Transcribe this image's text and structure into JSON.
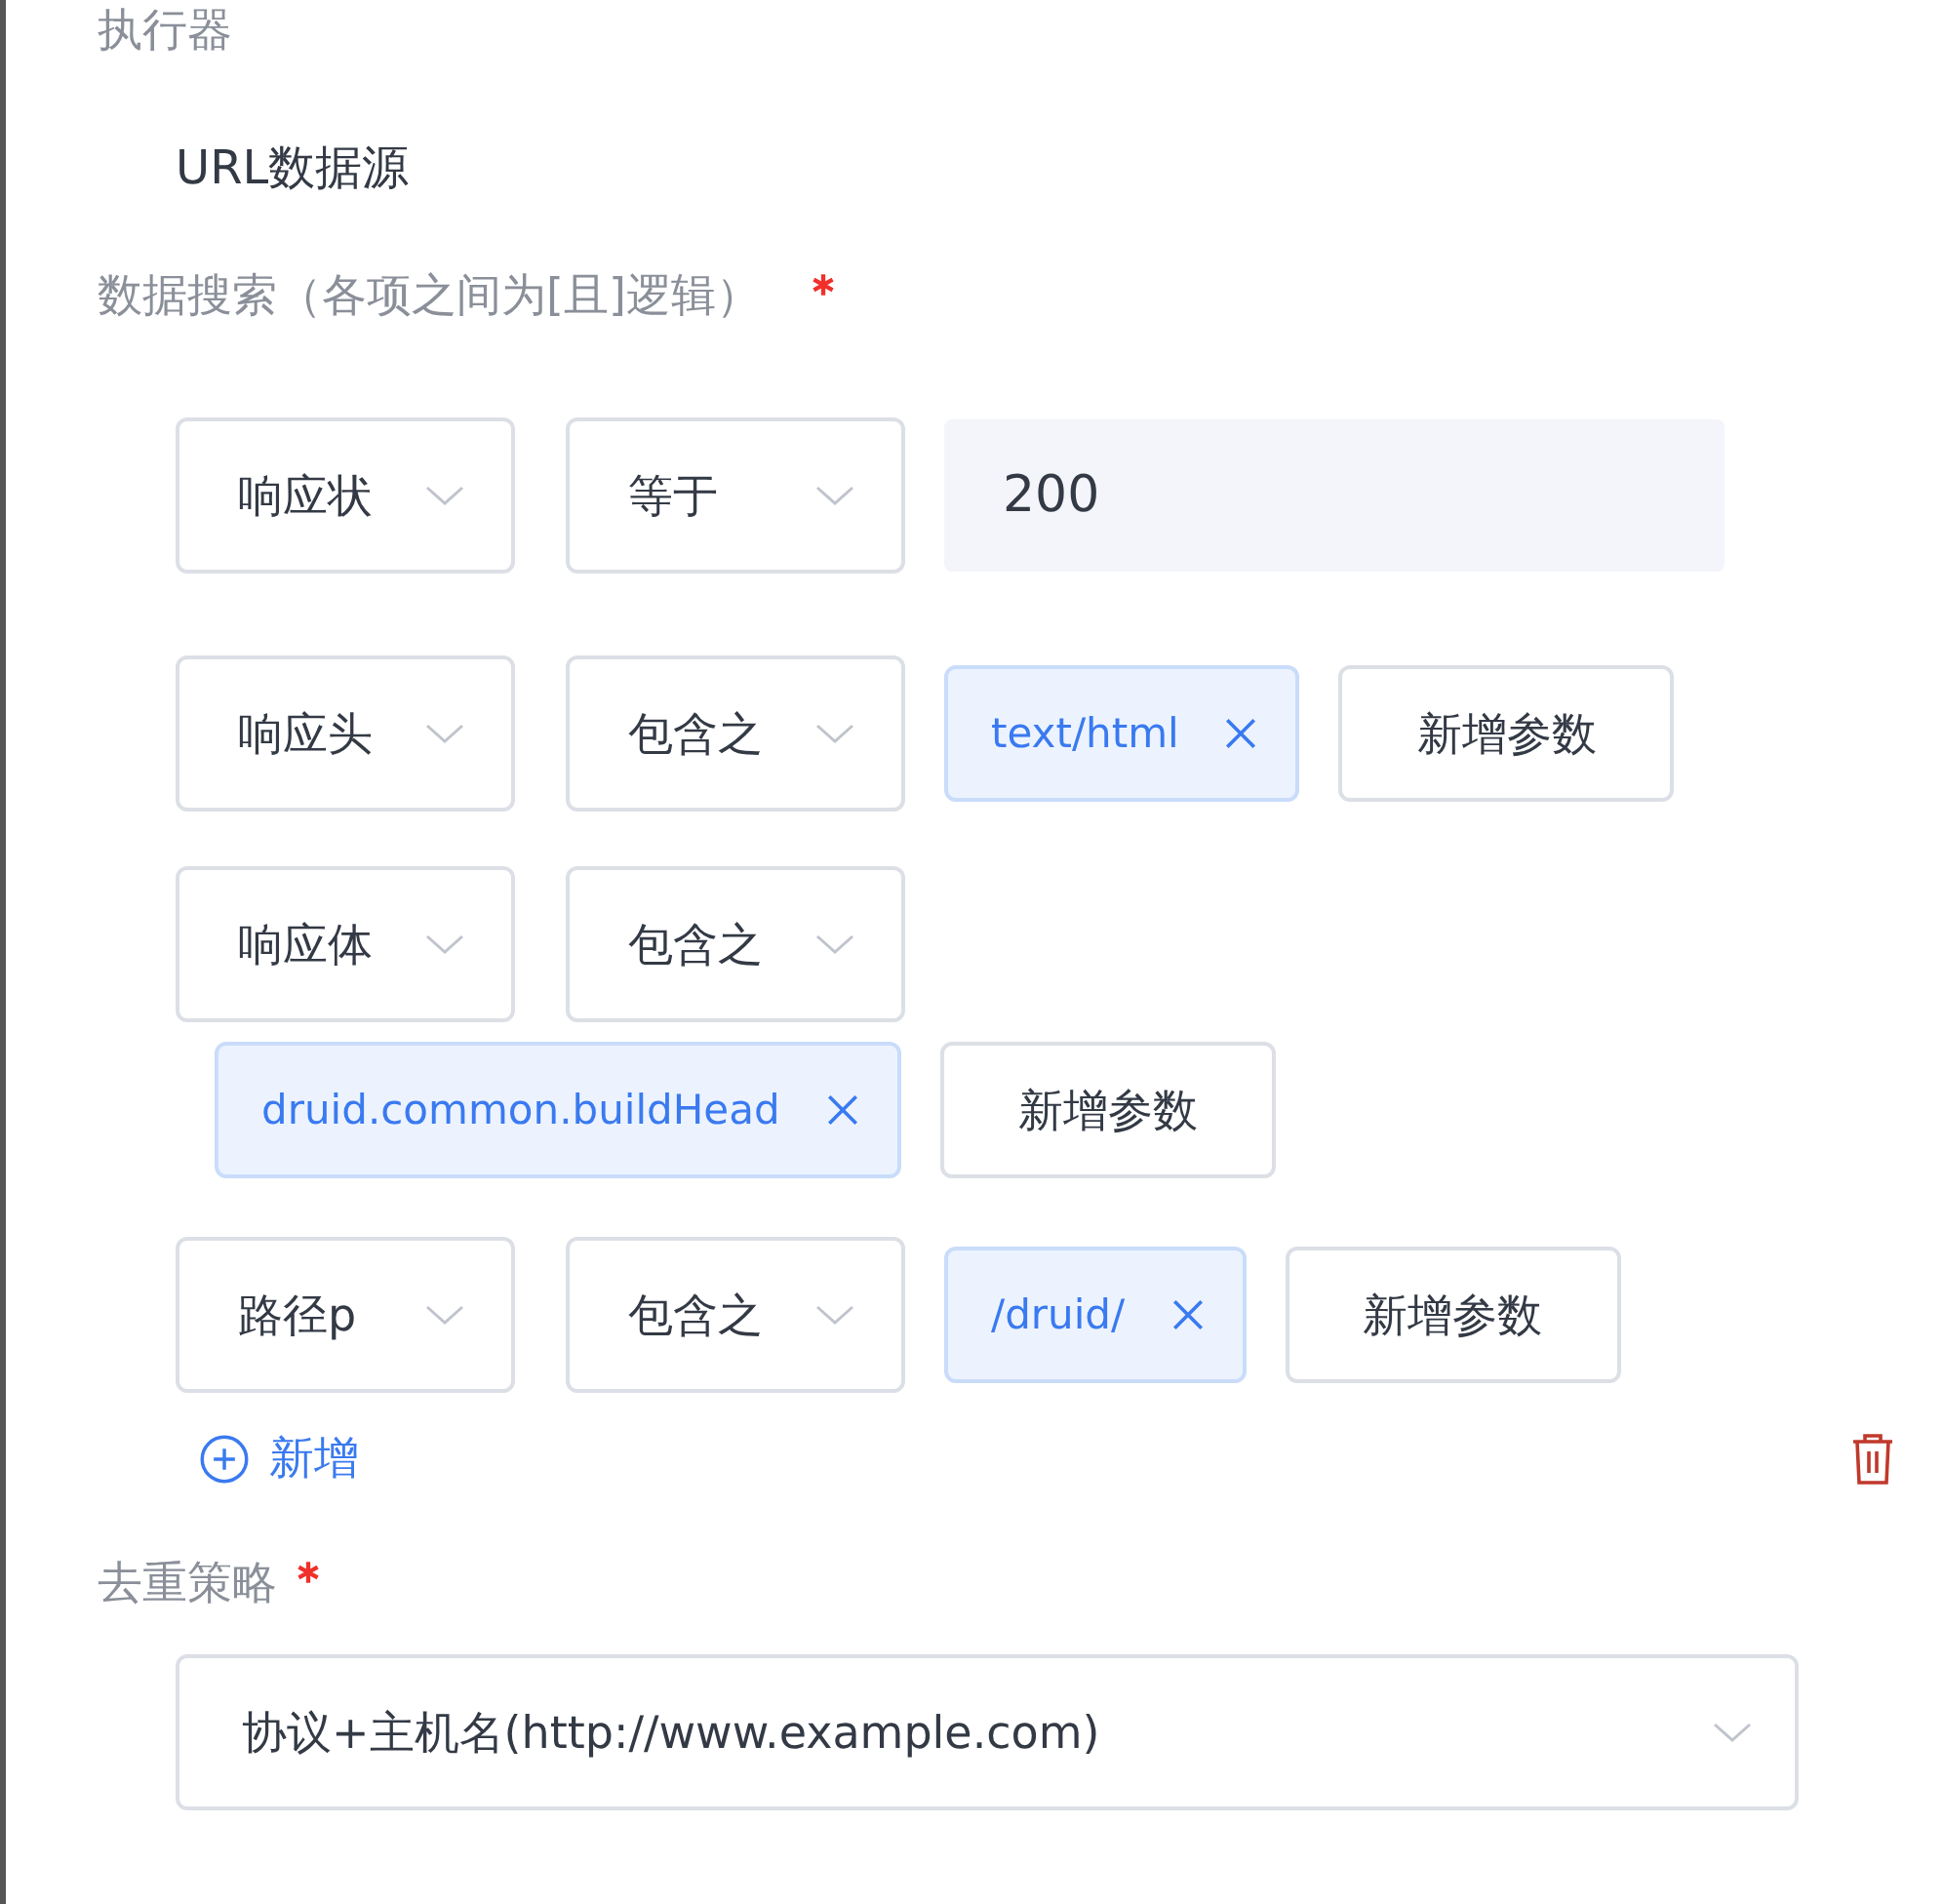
{
  "executor": {
    "label": "执行器",
    "value": "URL数据源"
  },
  "search": {
    "label": "数据搜索（各项之间为[且]逻辑）",
    "required": true,
    "conditions": [
      {
        "field": "响应状",
        "operator": "等于",
        "kind": "input",
        "value": "200"
      },
      {
        "field": "响应头",
        "operator": "包含之",
        "kind": "tags",
        "tags": [
          "text/html"
        ],
        "add_button": "新增参数"
      },
      {
        "field": "响应体",
        "operator": "包含之",
        "kind": "tags",
        "tags": [
          "druid.common.buildHead"
        ],
        "add_button": "新增参数"
      },
      {
        "field": "路径p",
        "operator": "包含之",
        "kind": "tags",
        "tags": [
          "/druid/"
        ],
        "add_button": "新增参数"
      }
    ],
    "add_link": "新增"
  },
  "dedup": {
    "label": "去重策略",
    "required": true,
    "value": "协议+主机名(http://www.example.com)"
  }
}
